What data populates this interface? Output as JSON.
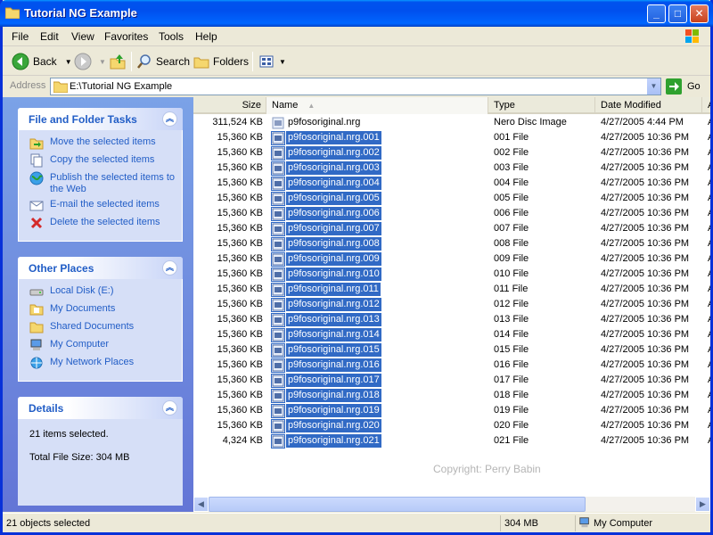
{
  "window": {
    "title": "Tutorial NG Example"
  },
  "menu": [
    "File",
    "Edit",
    "View",
    "Favorites",
    "Tools",
    "Help"
  ],
  "toolbar": {
    "back": "Back",
    "search": "Search",
    "folders": "Folders"
  },
  "address": {
    "label": "Address",
    "value": "E:\\Tutorial NG Example",
    "go": "Go"
  },
  "tasks": {
    "title": "File and Folder Tasks",
    "items": [
      "Move the selected items",
      "Copy the selected items",
      "Publish the selected items to the Web",
      "E-mail the selected items",
      "Delete the selected items"
    ]
  },
  "places": {
    "title": "Other Places",
    "items": [
      "Local Disk (E:)",
      "My Documents",
      "Shared Documents",
      "My Computer",
      "My Network Places"
    ]
  },
  "details": {
    "title": "Details",
    "line1": "21 items selected.",
    "line2": "Total File Size: 304 MB"
  },
  "columns": {
    "size": "Size",
    "name": "Name",
    "type": "Type",
    "date": "Date Modified",
    "extra": "A"
  },
  "files": [
    {
      "size": "311,524 KB",
      "name": "p9fosoriginal.nrg",
      "type": "Nero Disc Image",
      "date": "4/27/2005 4:44 PM",
      "extra": "A",
      "selected": false
    },
    {
      "size": "15,360 KB",
      "name": "p9fosoriginal.nrg.001",
      "type": "001 File",
      "date": "4/27/2005 10:36 PM",
      "extra": "A",
      "selected": true
    },
    {
      "size": "15,360 KB",
      "name": "p9fosoriginal.nrg.002",
      "type": "002 File",
      "date": "4/27/2005 10:36 PM",
      "extra": "A",
      "selected": true
    },
    {
      "size": "15,360 KB",
      "name": "p9fosoriginal.nrg.003",
      "type": "003 File",
      "date": "4/27/2005 10:36 PM",
      "extra": "A",
      "selected": true
    },
    {
      "size": "15,360 KB",
      "name": "p9fosoriginal.nrg.004",
      "type": "004 File",
      "date": "4/27/2005 10:36 PM",
      "extra": "A",
      "selected": true
    },
    {
      "size": "15,360 KB",
      "name": "p9fosoriginal.nrg.005",
      "type": "005 File",
      "date": "4/27/2005 10:36 PM",
      "extra": "A",
      "selected": true
    },
    {
      "size": "15,360 KB",
      "name": "p9fosoriginal.nrg.006",
      "type": "006 File",
      "date": "4/27/2005 10:36 PM",
      "extra": "A",
      "selected": true
    },
    {
      "size": "15,360 KB",
      "name": "p9fosoriginal.nrg.007",
      "type": "007 File",
      "date": "4/27/2005 10:36 PM",
      "extra": "A",
      "selected": true
    },
    {
      "size": "15,360 KB",
      "name": "p9fosoriginal.nrg.008",
      "type": "008 File",
      "date": "4/27/2005 10:36 PM",
      "extra": "A",
      "selected": true
    },
    {
      "size": "15,360 KB",
      "name": "p9fosoriginal.nrg.009",
      "type": "009 File",
      "date": "4/27/2005 10:36 PM",
      "extra": "A",
      "selected": true
    },
    {
      "size": "15,360 KB",
      "name": "p9fosoriginal.nrg.010",
      "type": "010 File",
      "date": "4/27/2005 10:36 PM",
      "extra": "A",
      "selected": true
    },
    {
      "size": "15,360 KB",
      "name": "p9fosoriginal.nrg.011",
      "type": "011 File",
      "date": "4/27/2005 10:36 PM",
      "extra": "A",
      "selected": true
    },
    {
      "size": "15,360 KB",
      "name": "p9fosoriginal.nrg.012",
      "type": "012 File",
      "date": "4/27/2005 10:36 PM",
      "extra": "A",
      "selected": true
    },
    {
      "size": "15,360 KB",
      "name": "p9fosoriginal.nrg.013",
      "type": "013 File",
      "date": "4/27/2005 10:36 PM",
      "extra": "A",
      "selected": true
    },
    {
      "size": "15,360 KB",
      "name": "p9fosoriginal.nrg.014",
      "type": "014 File",
      "date": "4/27/2005 10:36 PM",
      "extra": "A",
      "selected": true
    },
    {
      "size": "15,360 KB",
      "name": "p9fosoriginal.nrg.015",
      "type": "015 File",
      "date": "4/27/2005 10:36 PM",
      "extra": "A",
      "selected": true
    },
    {
      "size": "15,360 KB",
      "name": "p9fosoriginal.nrg.016",
      "type": "016 File",
      "date": "4/27/2005 10:36 PM",
      "extra": "A",
      "selected": true
    },
    {
      "size": "15,360 KB",
      "name": "p9fosoriginal.nrg.017",
      "type": "017 File",
      "date": "4/27/2005 10:36 PM",
      "extra": "A",
      "selected": true
    },
    {
      "size": "15,360 KB",
      "name": "p9fosoriginal.nrg.018",
      "type": "018 File",
      "date": "4/27/2005 10:36 PM",
      "extra": "A",
      "selected": true
    },
    {
      "size": "15,360 KB",
      "name": "p9fosoriginal.nrg.019",
      "type": "019 File",
      "date": "4/27/2005 10:36 PM",
      "extra": "A",
      "selected": true
    },
    {
      "size": "15,360 KB",
      "name": "p9fosoriginal.nrg.020",
      "type": "020 File",
      "date": "4/27/2005 10:36 PM",
      "extra": "A",
      "selected": true
    },
    {
      "size": "4,324 KB",
      "name": "p9fosoriginal.nrg.021",
      "type": "021 File",
      "date": "4/27/2005 10:36 PM",
      "extra": "A",
      "selected": true
    }
  ],
  "watermark": "Copyright: Perry Babin",
  "status": {
    "left": "21 objects selected",
    "size": "304 MB",
    "zone": "My Computer"
  },
  "colors": {
    "selection": "#316ac5",
    "link": "#215dc6",
    "titlebar": "#0053ee"
  }
}
